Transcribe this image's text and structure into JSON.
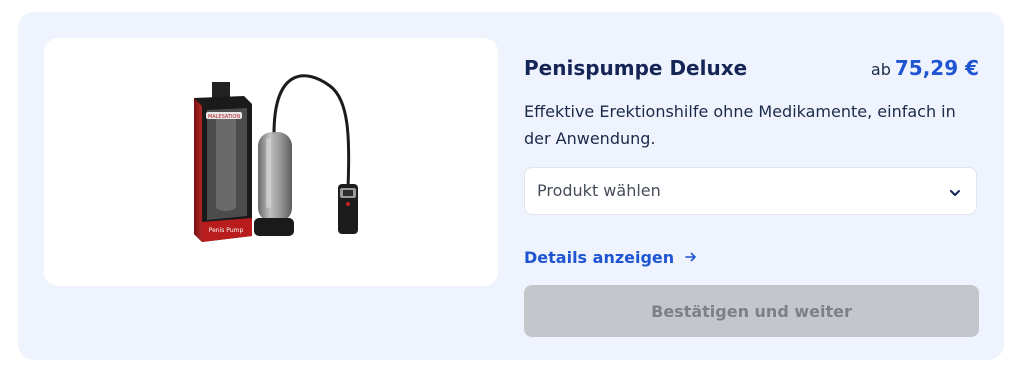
{
  "product": {
    "name": "Penispumpe Deluxe",
    "price_prefix": "ab",
    "price": "75,29 €",
    "description": "Effektive Erektionshilfe ohne Medikamente, einfach in der Anwendung.",
    "image": {
      "box_brand": "MALESATION",
      "box_label": "Penis Pump"
    }
  },
  "variant_select": {
    "value": "Produkt wählen"
  },
  "details_link": {
    "label": "Details anzeigen"
  },
  "confirm_button": {
    "label": "Bestätigen und weiter",
    "disabled": true
  },
  "colors": {
    "accent": "#1f55d1",
    "title": "#142556",
    "card_bg": "#eef3fd",
    "button_disabled": "#c4c6cb"
  },
  "icons": [
    "chevron-down-icon",
    "arrow-right-icon"
  ]
}
